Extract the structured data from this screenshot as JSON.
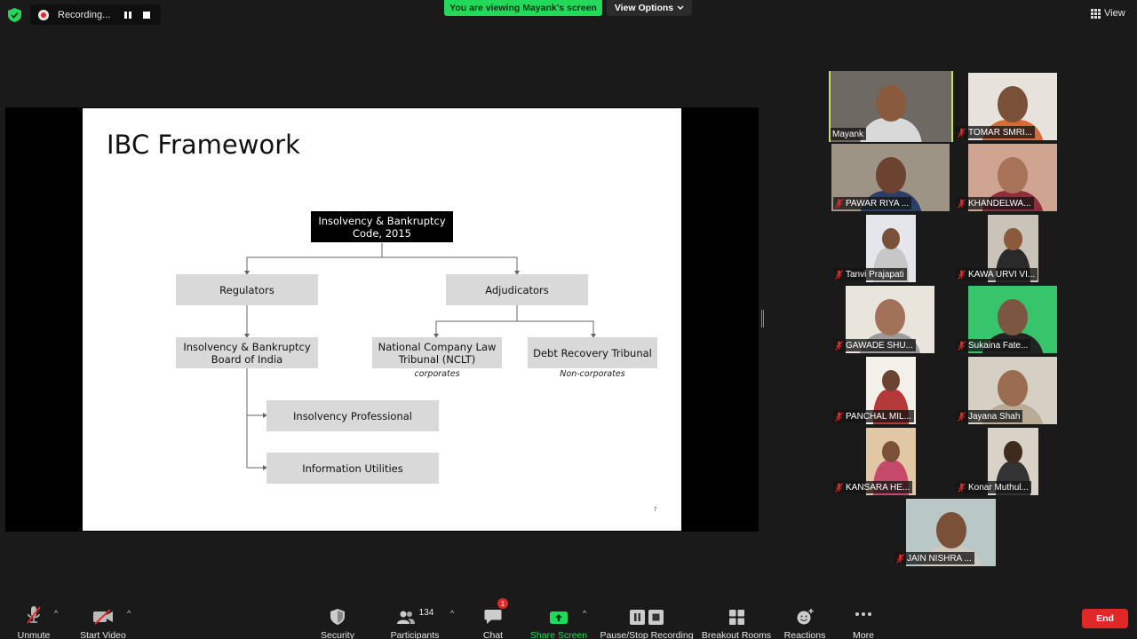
{
  "top_bar": {
    "recording_label": "Recording...",
    "viewing_banner": "You are viewing Mayank's screen",
    "view_options_label": "View Options",
    "view_label": "View"
  },
  "slide": {
    "title": "IBC Framework",
    "root": "Insolvency & Bankruptcy\nCode, 2015",
    "regulators": "Regulators",
    "adjudicators": "Adjudicators",
    "ibbi": "Insolvency & Bankruptcy\nBoard of India",
    "nclt": "National Company Law\nTribunal (NCLT)",
    "nclt_caption": "corporates",
    "drt": "Debt Recovery Tribunal",
    "drt_caption": "Non-corporates",
    "ip": "Insolvency Professional",
    "iu": "Information Utilities",
    "page_number": "7"
  },
  "participants_gallery": [
    {
      "name": "Mayank",
      "muted": false,
      "active": true
    },
    {
      "name": "TOMAR SMRI...",
      "muted": true
    },
    {
      "name": "PAWAR RIYA ...",
      "muted": true
    },
    {
      "name": "KHANDELWA...",
      "muted": true
    },
    {
      "name": "Tanvi Prajapati",
      "muted": true
    },
    {
      "name": "KAWA URVI VI...",
      "muted": true
    },
    {
      "name": "GAWADE SHU...",
      "muted": true
    },
    {
      "name": "Sukaina Fate...",
      "muted": true
    },
    {
      "name": "PANCHAL MIL...",
      "muted": true
    },
    {
      "name": "Jayana Shah",
      "muted": true
    },
    {
      "name": "KANSARA HE...",
      "muted": true
    },
    {
      "name": "Konar Muthul...",
      "muted": true
    },
    {
      "name": "JAIN NISHRA ...",
      "muted": true
    }
  ],
  "toolbar": {
    "unmute": "Unmute",
    "start_video": "Start Video",
    "security": "Security",
    "participants": "Participants",
    "participants_count": "134",
    "chat": "Chat",
    "chat_badge": "1",
    "share_screen": "Share Screen",
    "pause_stop_recording": "Pause/Stop Recording",
    "breakout_rooms": "Breakout Rooms",
    "reactions": "Reactions",
    "more": "More",
    "end": "End"
  },
  "colors": {
    "share_green": "#23d959",
    "end_red": "#e02828",
    "active_speaker": "#c5e05a"
  }
}
